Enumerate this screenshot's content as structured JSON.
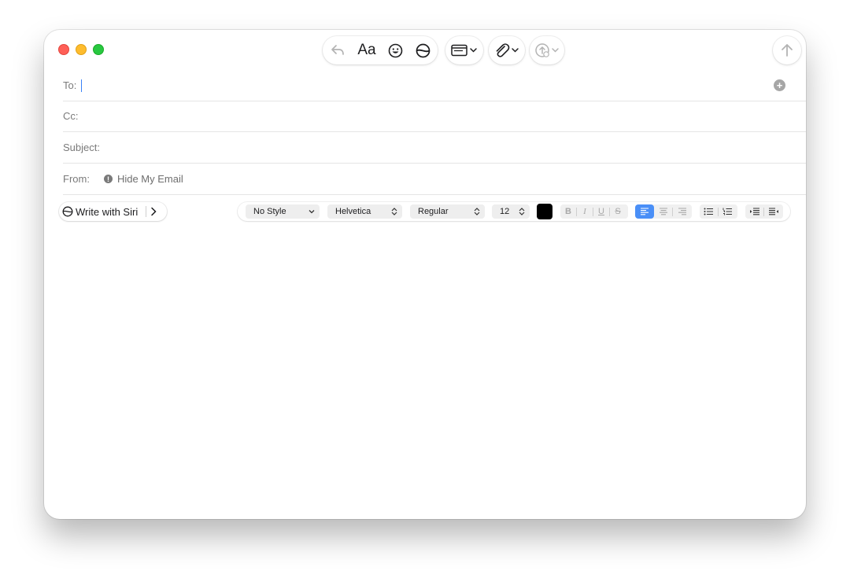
{
  "icons": {
    "reply": "reply-arrow-icon",
    "format": "Aa",
    "emoji": "smiley-icon",
    "siri": "siri-icon",
    "header_fields": "header-fields-icon",
    "attach": "paperclip-icon",
    "photo": "upload-icon",
    "send": "send-arrow-icon"
  },
  "header": {
    "to_label": "To:",
    "cc_label": "Cc:",
    "subject_label": "Subject:",
    "from_label": "From:",
    "from_value": "Hide My Email",
    "add_symbol": "+",
    "info_symbol": "!"
  },
  "format_bar": {
    "siri_label": "Write with Siri",
    "style": "No Style",
    "font": "Helvetica",
    "weight": "Regular",
    "size": "12",
    "bold": "B",
    "italic": "I",
    "underline": "U",
    "strike": "S"
  },
  "colors": {
    "text_color": "#000000",
    "accent": "#4a8ff7"
  }
}
